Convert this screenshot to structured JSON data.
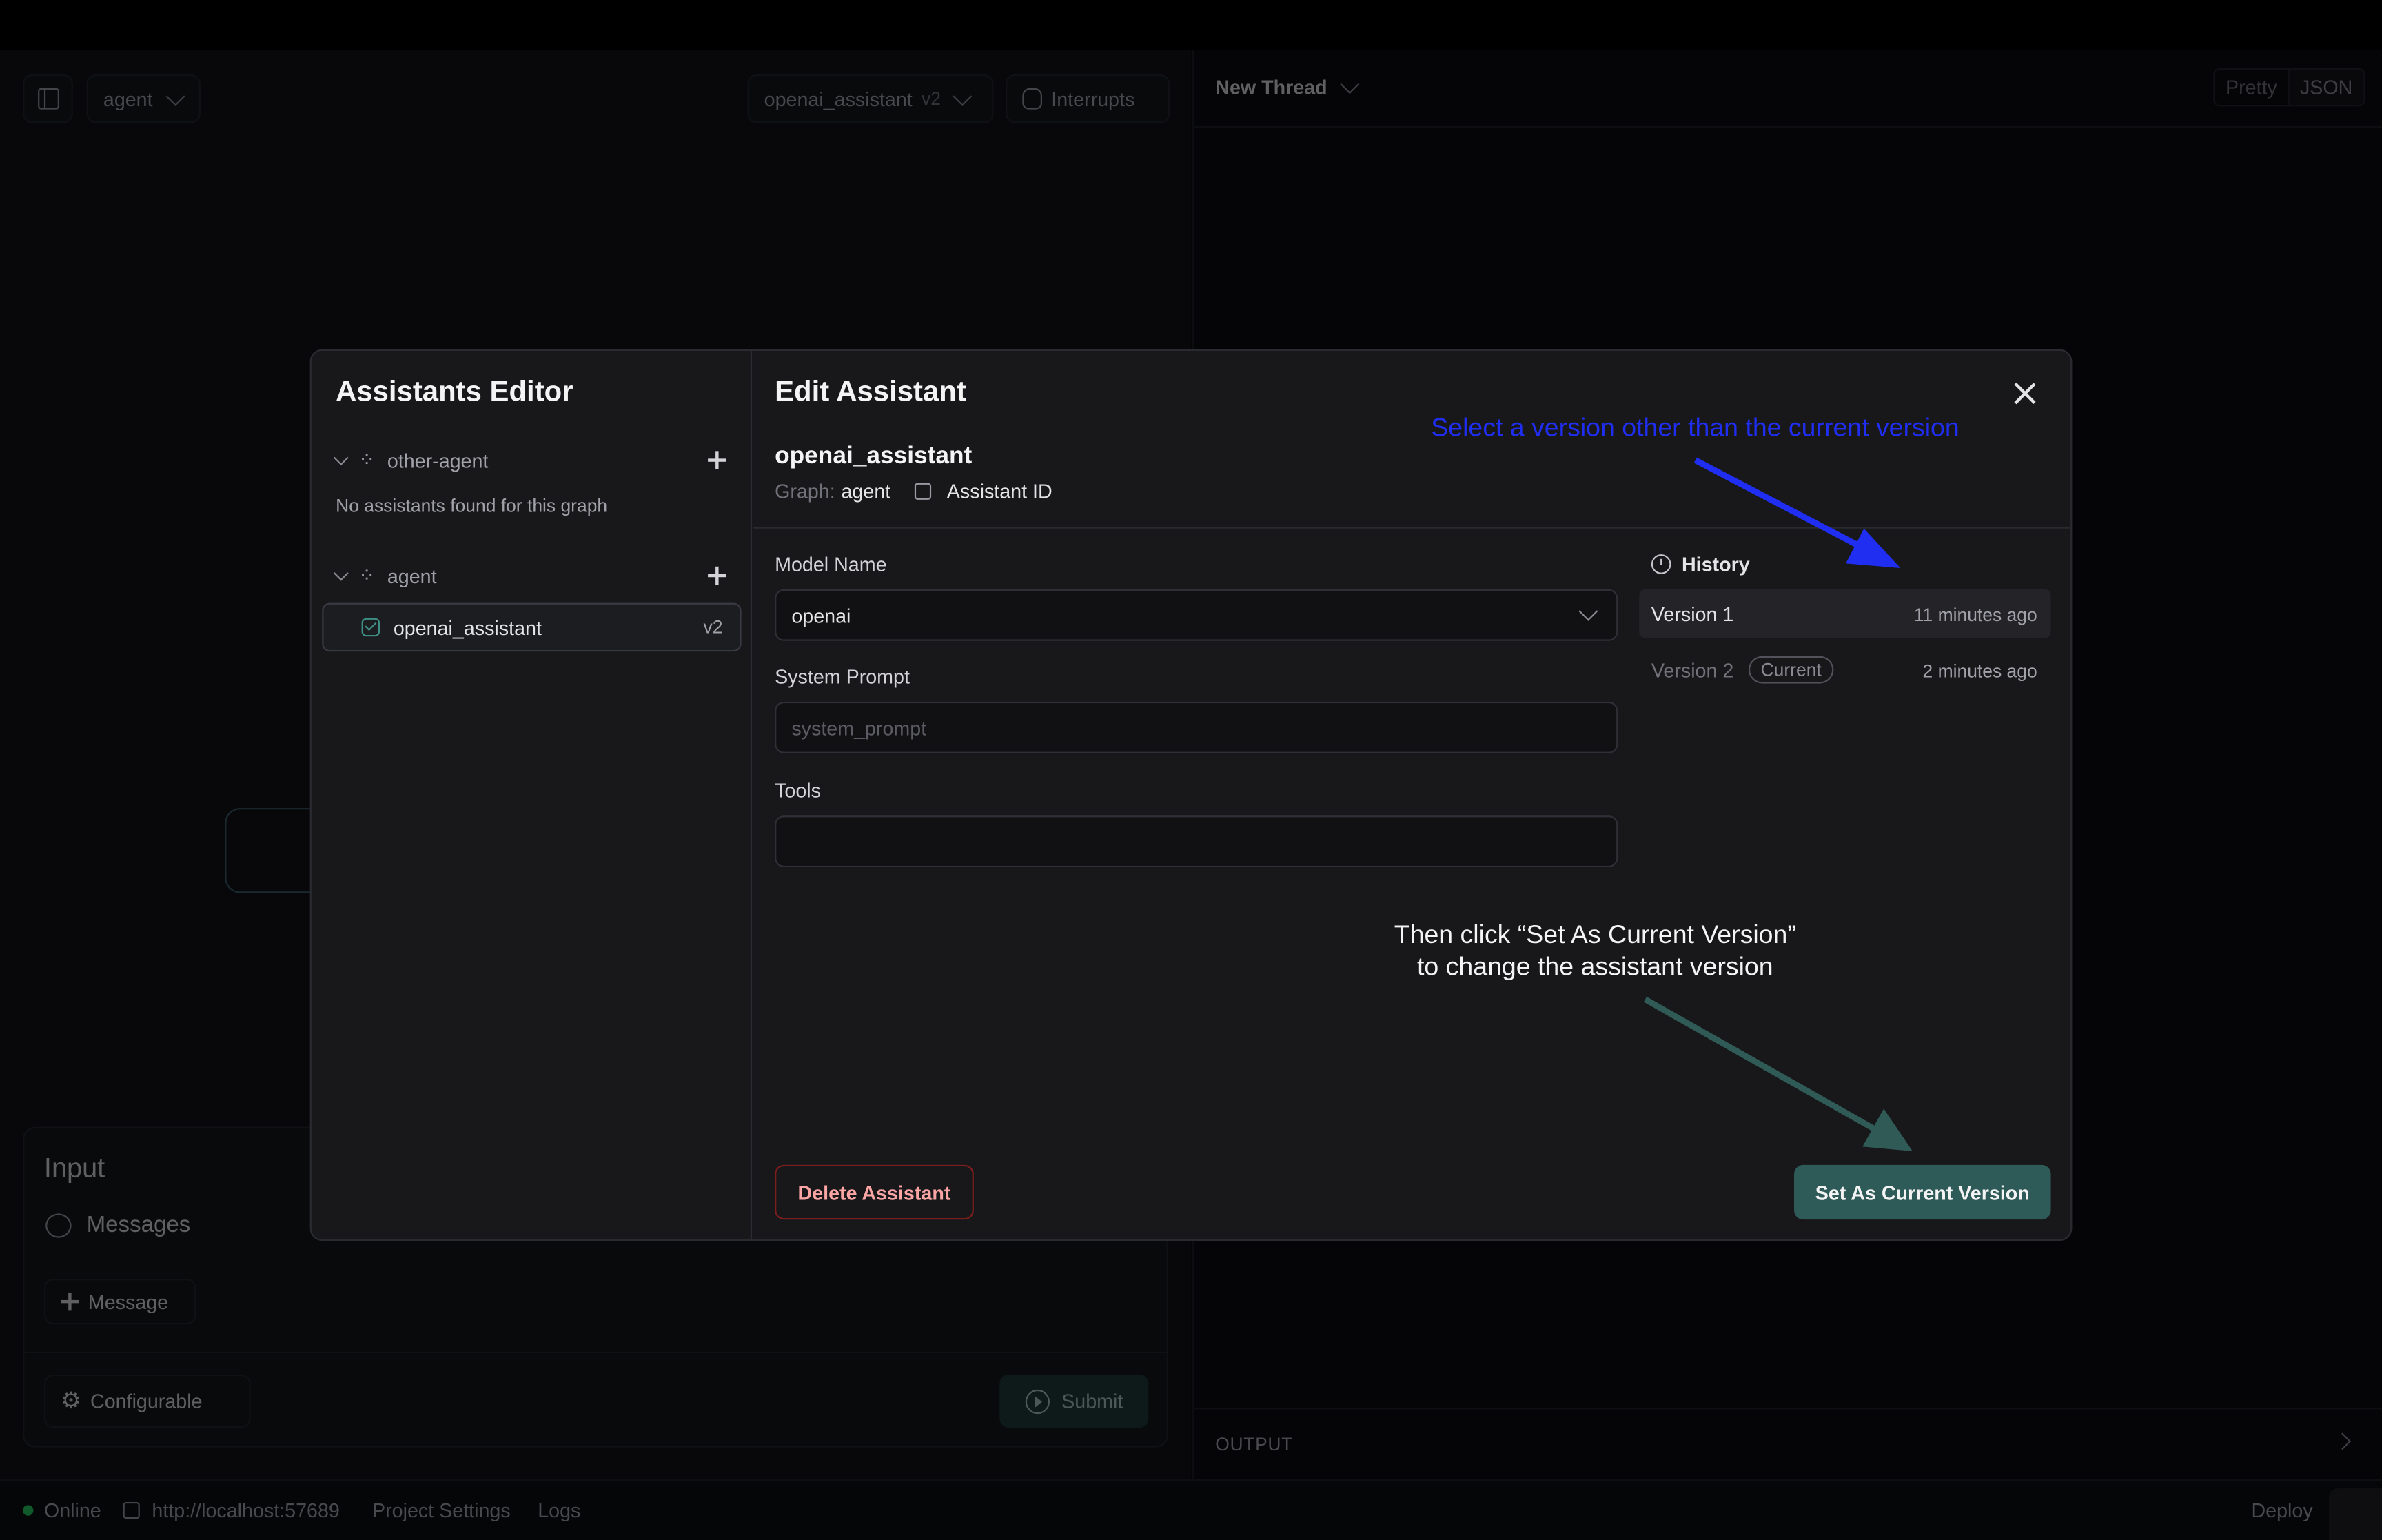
{
  "topbar": {
    "graph_select": "agent",
    "assistant_select": "openai_assistant",
    "assistant_version": "v2",
    "interrupts_label": "Interrupts"
  },
  "thread": {
    "title": "New Thread",
    "view_pretty": "Pretty",
    "view_json": "JSON",
    "output_label": "OUTPUT"
  },
  "input_panel": {
    "title": "Input",
    "messages_label": "Messages",
    "add_message_label": "Message",
    "configurable_label": "Configurable",
    "submit_label": "Submit"
  },
  "statusbar": {
    "status": "Online",
    "url": "http://localhost:57689",
    "project_settings": "Project Settings",
    "logs": "Logs",
    "deploy": "Deploy"
  },
  "editor": {
    "title": "Assistants Editor",
    "graphs": [
      {
        "name": "other-agent",
        "empty_text": "No assistants found for this graph"
      },
      {
        "name": "agent",
        "assistant": "openai_assistant",
        "version": "v2"
      }
    ]
  },
  "edit": {
    "title": "Edit Assistant",
    "assistant_name": "openai_assistant",
    "graph_prefix": "Graph:",
    "graph_value": "agent",
    "assistant_id_label": "Assistant ID",
    "model_name_label": "Model Name",
    "model_name_value": "openai",
    "system_prompt_label": "System Prompt",
    "system_prompt_placeholder": "system_prompt",
    "tools_label": "Tools",
    "delete_label": "Delete Assistant",
    "set_current_label": "Set As Current Version"
  },
  "history": {
    "title": "History",
    "versions": [
      {
        "label": "Version 1",
        "time": "11 minutes ago"
      },
      {
        "label": "Version 2",
        "badge": "Current",
        "time": "2 minutes ago"
      }
    ]
  },
  "annotations": {
    "top_note": "Select a version other than the current version",
    "bottom_note_line1": "Then click “Set As Current Version”",
    "bottom_note_line2": "to change the assistant version",
    "top_color": "#1f2ef0",
    "bottom_color": "#2f5a56"
  },
  "colors": {
    "accent": "#2e5b58",
    "online": "#22c55e",
    "danger": "#7f1d1d"
  }
}
